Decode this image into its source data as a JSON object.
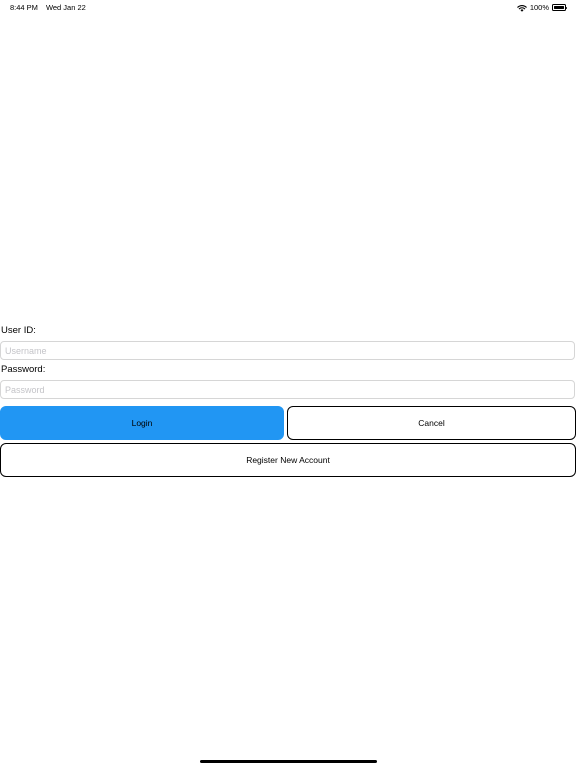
{
  "status_bar": {
    "time": "8:44 PM",
    "date": "Wed Jan 22",
    "battery_text": "100%",
    "battery_level": 1.0,
    "wifi_icon": "wifi-icon",
    "battery_icon": "battery-icon"
  },
  "login_form": {
    "user_id_label": "User ID:",
    "username_placeholder": "Username",
    "username_value": "",
    "password_label": "Password:",
    "password_placeholder": "Password",
    "password_value": "",
    "login_label": "Login",
    "cancel_label": "Cancel",
    "register_label": "Register New Account"
  },
  "colors": {
    "primary_button": "#2196f3",
    "background": "#ffffff",
    "input_border": "#d6d6d6",
    "placeholder": "#c4c4c8"
  }
}
